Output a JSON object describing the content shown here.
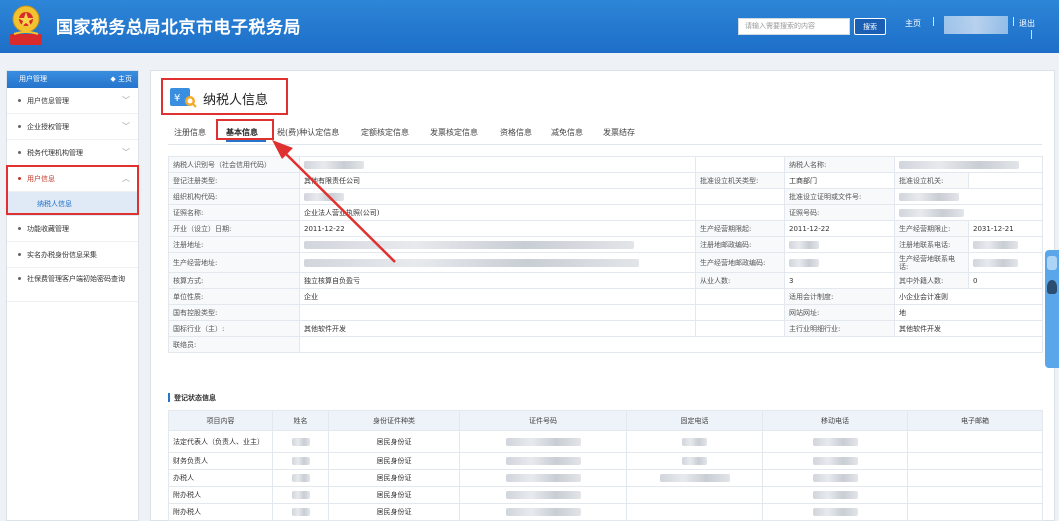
{
  "header": {
    "title": "国家税务总局北京市电子税务局",
    "search_placeholder": "请输入需要搜索的内容",
    "search_button": "搜索",
    "home": "主页",
    "exit": "退出"
  },
  "sidebar": {
    "header": "用户管理",
    "home": "主页",
    "items": [
      {
        "label": "用户信息管理"
      },
      {
        "label": "企业授权管理"
      },
      {
        "label": "税务代理机构管理"
      },
      {
        "label": "用户信息"
      },
      {
        "label": "纳税人信息"
      },
      {
        "label": "功能收藏管理"
      },
      {
        "label": "实名办税身份信息采集"
      },
      {
        "label": "社保费管理客户端初始密码查询"
      }
    ]
  },
  "page": {
    "title": "纳税人信息",
    "tabs": [
      "注册信息",
      "基本信息",
      "税(费)种认定信息",
      "定额核定信息",
      "发票核定信息",
      "资格信息",
      "减免信息",
      "发票结存"
    ]
  },
  "info": {
    "taxpayer_id_label": "纳税人识别号（社会信用代码）",
    "taxpayer_name_label": "纳税人名称:",
    "reg_type_label": "登记注册类型:",
    "reg_type_value": "其他有限责任公司",
    "approve_type_label": "批准设立机关类型:",
    "approve_type_value": "工商部门",
    "approve_org_label": "批准设立机关:",
    "org_code_label": "组织机构代码:",
    "approve_doc_label": "批准设立证明或文件号:",
    "cert_name_label": "证照名称:",
    "cert_name_value": "企业法人营业执照(公司)",
    "cert_no_label": "证照号码:",
    "open_date_label": "开业（设立）日期:",
    "open_date_value": "2011-12-22",
    "period_start_label": "生产经营期限起:",
    "period_start_value": "2011-12-22",
    "period_end_label": "生产经营期限止:",
    "period_end_value": "2031-12-21",
    "reg_addr_label": "注册地址:",
    "reg_post_label": "注册地邮政编码:",
    "reg_phone_label": "注册地联系电话:",
    "biz_addr_label": "生产经营地址:",
    "biz_post_label": "生产经营地邮政编码:",
    "biz_phone_label": "生产经营地联系电话:",
    "account_label": "核算方式:",
    "account_value": "独立核算自负盈亏",
    "employees_label": "从业人数:",
    "employees_value": "3",
    "foreign_label": "其中外籍人数:",
    "foreign_value": "0",
    "unit_label": "单位性质:",
    "unit_value": "企业",
    "accounting_label": "适用会计制度:",
    "accounting_value": "小企业会计准则",
    "state_label": "国有控股类型:",
    "website_label": "网站网址:",
    "website_value": "地",
    "industry_label": "国标行业（主）:",
    "industry_value": "其他软件开发",
    "main_detail_label": "主行业明细行业:",
    "main_detail_value": "其他软件开发",
    "contact_label": "联络员:"
  },
  "registration": {
    "section_title": "登记状态信息",
    "columns": [
      "项目内容",
      "姓名",
      "身份证件种类",
      "证件号码",
      "固定电话",
      "移动电话",
      "电子邮箱"
    ],
    "rows": [
      {
        "item": "法定代表人（负责人、业主）",
        "id_type": "居民身份证"
      },
      {
        "item": "财务负责人",
        "id_type": "居民身份证"
      },
      {
        "item": "办税人",
        "id_type": "居民身份证"
      },
      {
        "item": "附办税人",
        "id_type": "居民身份证"
      },
      {
        "item": "附办税人",
        "id_type": "居民身份证"
      }
    ]
  },
  "colors": {
    "header_blue": "#1d6ec7",
    "highlight_red": "#e03131",
    "tab_underline": "#2674cc"
  }
}
